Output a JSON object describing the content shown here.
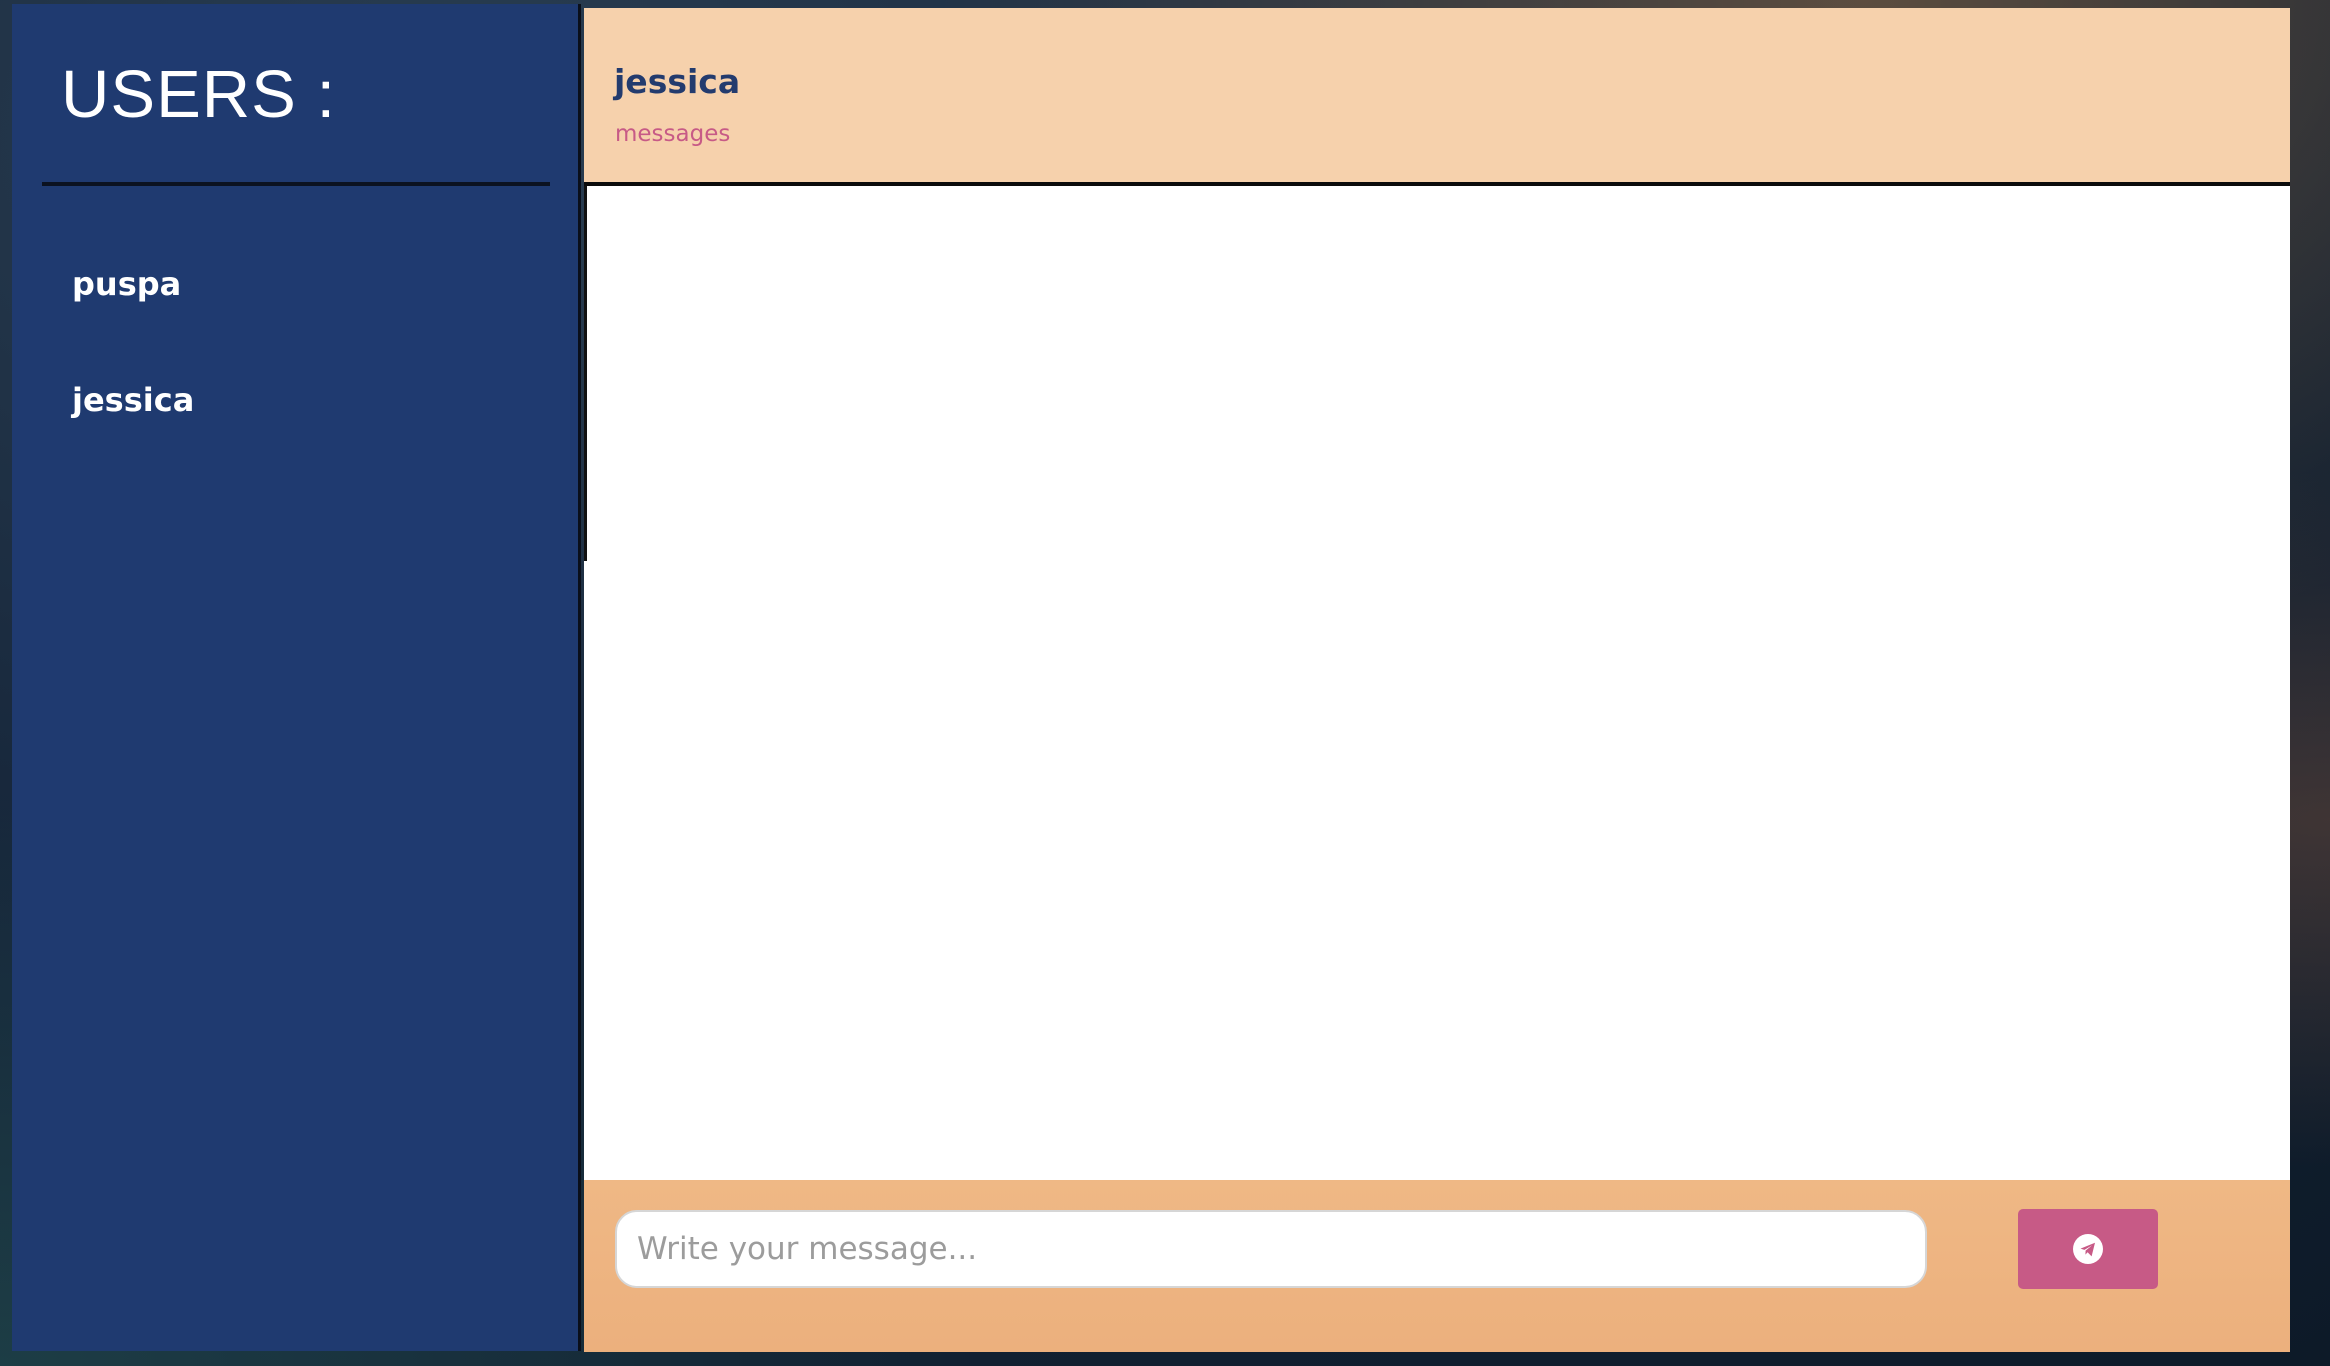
{
  "sidebar": {
    "title": "USERS :",
    "users": [
      {
        "name": "puspa"
      },
      {
        "name": "jessica"
      }
    ]
  },
  "chat": {
    "header": {
      "name": "jessica",
      "subtitle": "messages"
    },
    "input": {
      "placeholder": "Write your message...",
      "value": ""
    },
    "send_icon": "paper-plane-icon"
  },
  "colors": {
    "sidebar_bg": "#1f3a70",
    "header_bg": "#f6d1ac",
    "footer_bg": "#efb885",
    "accent": "#c75a86",
    "header_name": "#233b6e"
  }
}
